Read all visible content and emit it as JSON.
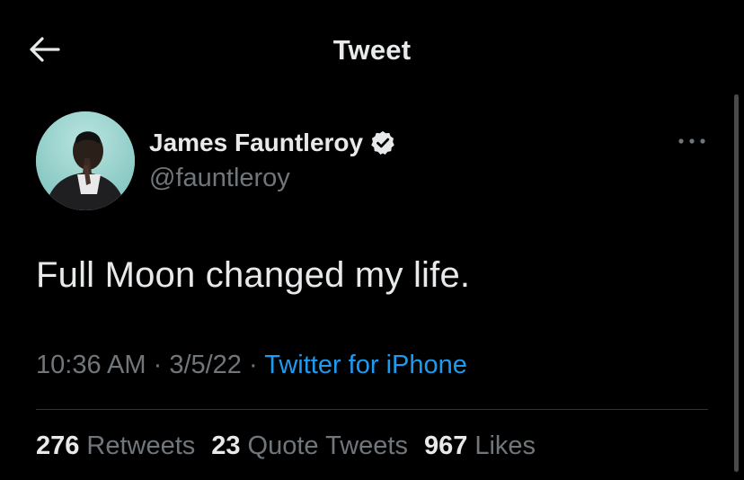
{
  "header": {
    "title": "Tweet",
    "back_icon": "arrow-left-icon"
  },
  "author": {
    "name": "James Fauntleroy",
    "handle": "@fauntleroy",
    "verified": true,
    "verified_icon": "verified-badge-icon"
  },
  "tweet": {
    "text": "Full Moon changed my life.",
    "time": "10:36 AM",
    "date": "3/5/22",
    "separator": "·",
    "source": "Twitter for iPhone"
  },
  "stats": [
    {
      "count": "276",
      "label": "Retweets"
    },
    {
      "count": "23",
      "label": "Quote Tweets"
    },
    {
      "count": "967",
      "label": "Likes"
    }
  ],
  "colors": {
    "background": "#000000",
    "text_primary": "#e7e9ea",
    "text_secondary": "#71767b",
    "accent": "#1d9bf0",
    "divider": "#2f3336"
  }
}
